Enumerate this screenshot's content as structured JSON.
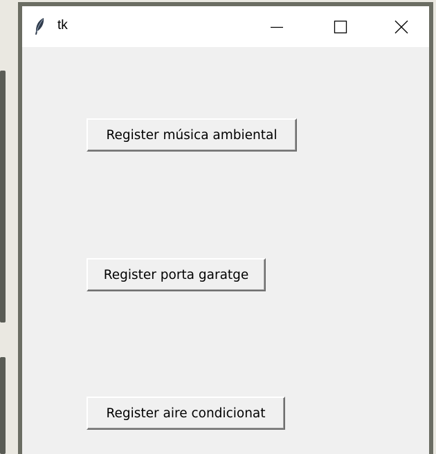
{
  "window": {
    "title": "tk",
    "controls": {
      "minimize_icon": "minimize-icon",
      "maximize_icon": "maximize-icon",
      "close_icon": "close-icon"
    }
  },
  "buttons": [
    {
      "label": "Register música ambiental"
    },
    {
      "label": "Register porta garatge"
    },
    {
      "label": "Register aire condicionat"
    }
  ],
  "colors": {
    "titlebar": "#ffffff",
    "client": "#f0f0f0",
    "window_border": "#6b6d63",
    "desktop": "#eae8e1"
  }
}
